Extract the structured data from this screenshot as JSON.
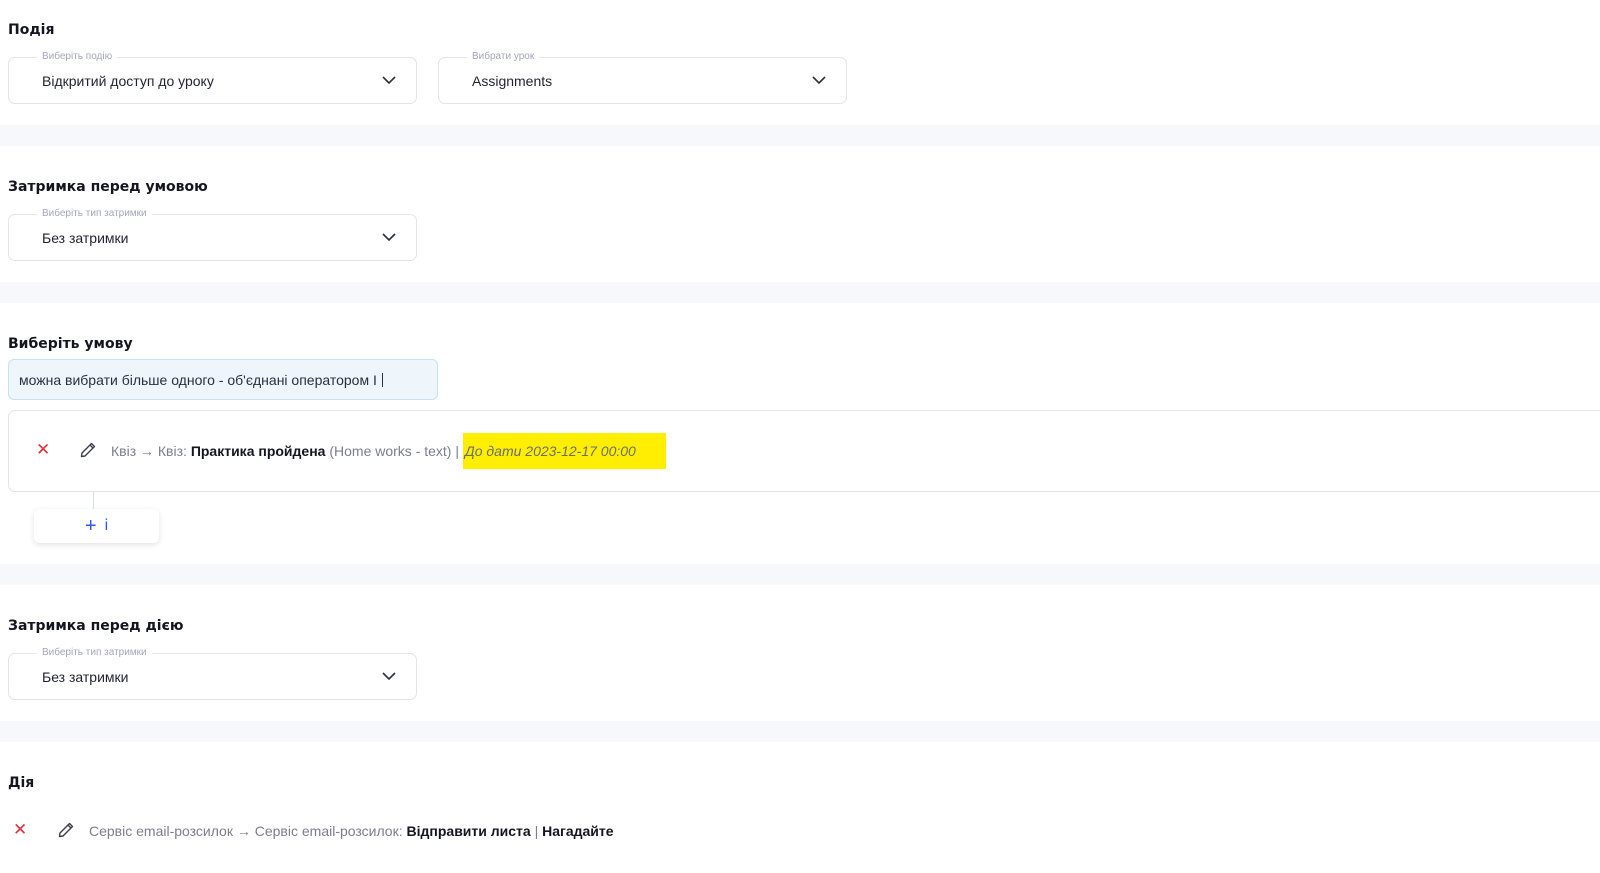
{
  "event": {
    "title": "Подія",
    "event_select": {
      "label": "Виберіть подію",
      "value": "Відкритий доступ до уроку"
    },
    "lesson_select": {
      "label": "Вибрати урок",
      "value": "Assignments"
    }
  },
  "delay_before_condition": {
    "title": "Затримка перед умовою",
    "select": {
      "label": "Виберіть тип затримки",
      "value": "Без затримки"
    }
  },
  "condition": {
    "title": "Виберіть умову",
    "hint_input_value": "можна вибрати більше одного - об'єднані оператором І",
    "rule": {
      "prefix": "Квіз → Квіз: ",
      "name": "Практика пройдена",
      "detail": " (Home works - text) | ",
      "deadline": "До дати 2023-12-17 00:00"
    },
    "add_button": {
      "plus": "+",
      "label": "і"
    }
  },
  "delay_before_action": {
    "title": "Затримка перед дією",
    "select": {
      "label": "Виберіть тип затримки",
      "value": "Без затримки"
    }
  },
  "action": {
    "title": "Дія",
    "rule": {
      "prefix": "Сервіс email-розсилок → Сервіс email-розсилок: ",
      "name": "Відправити листа",
      "separator": " | ",
      "detail": "Нагадайте"
    }
  },
  "colors": {
    "highlight": "#ffee00",
    "delete": "#e0313c",
    "accent": "#2f5ae3"
  },
  "icons": [
    "chevron-down-icon",
    "close-icon",
    "pencil-icon",
    "plus-icon"
  ]
}
